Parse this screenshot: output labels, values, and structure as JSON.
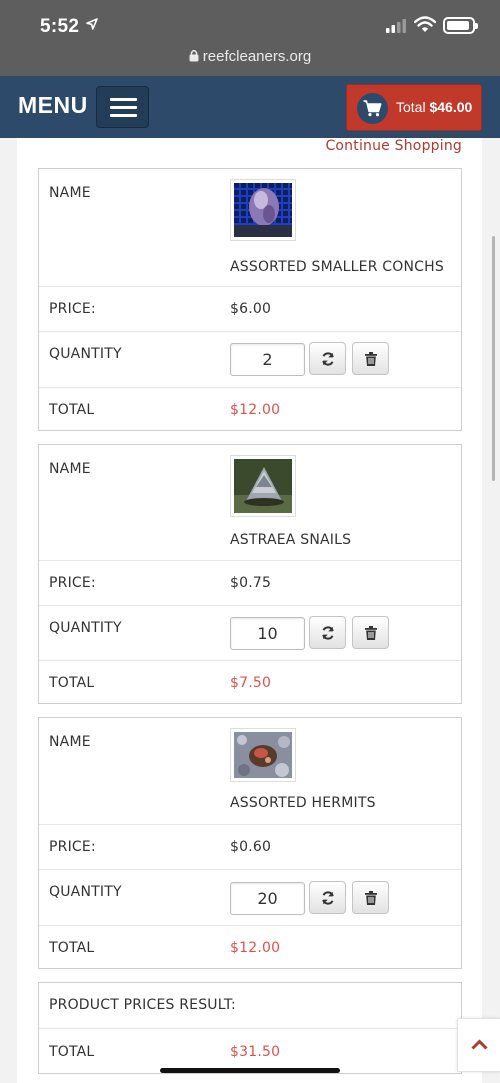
{
  "status_bar": {
    "time": "5:52",
    "url": "reefcleaners.org"
  },
  "header": {
    "menu_label": "MENU",
    "cart_label": "Total",
    "cart_total": "$46.00"
  },
  "continue_shopping": "Continue Shopping",
  "labels": {
    "name": "NAME",
    "price": "PRICE:",
    "quantity": "QUANTITY",
    "total": "TOTAL"
  },
  "items": [
    {
      "name": "ASSORTED SMALLER CONCHS",
      "price": "$6.00",
      "quantity": "2",
      "total": "$12.00"
    },
    {
      "name": "ASTRAEA SNAILS",
      "price": "$0.75",
      "quantity": "10",
      "total": "$7.50"
    },
    {
      "name": "ASSORTED HERMITS",
      "price": "$0.60",
      "quantity": "20",
      "total": "$12.00"
    }
  ],
  "summary": {
    "title": "PRODUCT PRICES RESULT:",
    "total_label": "TOTAL",
    "total": "$31.50"
  },
  "colors": {
    "header": "#2d4a6b",
    "cart_button": "#c0392b",
    "accent_red": "#e0524a",
    "link": "#b03a2e"
  },
  "icons": [
    "location-arrow-icon",
    "signal-icon",
    "wifi-icon",
    "battery-icon",
    "lock-icon",
    "hamburger-icon",
    "cart-icon",
    "refresh-icon",
    "trash-icon",
    "chevron-up-icon"
  ]
}
